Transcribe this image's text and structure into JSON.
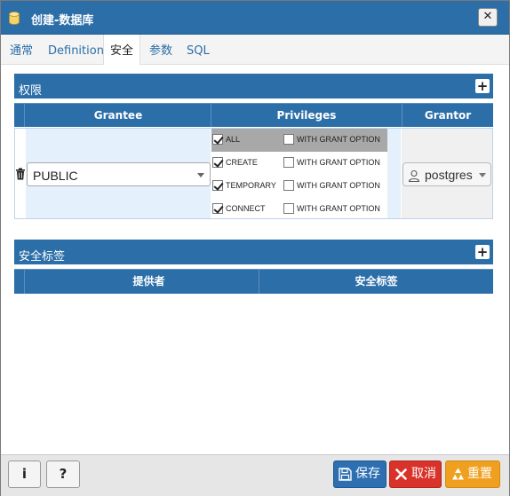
{
  "window": {
    "title": "创建-数据库",
    "close_label": "✕"
  },
  "tabs": [
    {
      "label": "通常",
      "active": false
    },
    {
      "label": "Definition",
      "active": false
    },
    {
      "label": "安全",
      "active": true
    },
    {
      "label": "参数",
      "active": false
    },
    {
      "label": "SQL",
      "active": false
    }
  ],
  "privileges_panel": {
    "title": "权限",
    "add_label": "+",
    "columns": [
      "Grantee",
      "Privileges",
      "Grantor"
    ],
    "rows": [
      {
        "grantee": "PUBLIC",
        "grantor": "postgres",
        "privileges": [
          {
            "name": "ALL",
            "checked": true,
            "with_grant_option_label": "WITH GRANT OPTION",
            "with_grant_option": false
          },
          {
            "name": "CREATE",
            "checked": true,
            "with_grant_option_label": "WITH GRANT OPTION",
            "with_grant_option": false
          },
          {
            "name": "TEMPORARY",
            "checked": true,
            "with_grant_option_label": "WITH GRANT OPTION",
            "with_grant_option": false
          },
          {
            "name": "CONNECT",
            "checked": true,
            "with_grant_option_label": "WITH GRANT OPTION",
            "with_grant_option": false
          }
        ]
      }
    ]
  },
  "security_labels_panel": {
    "title": "安全标签",
    "add_label": "+",
    "columns": [
      "提供者",
      "安全标签"
    ]
  },
  "footer": {
    "info_label": "i",
    "help_label": "?",
    "save_label": "保存",
    "cancel_label": "取消",
    "reset_label": "重置"
  },
  "colors": {
    "header_blue": "#2b6ea8",
    "save_blue": "#2d6fb0",
    "cancel_red": "#d9322b",
    "reset_orange": "#f0a020"
  }
}
